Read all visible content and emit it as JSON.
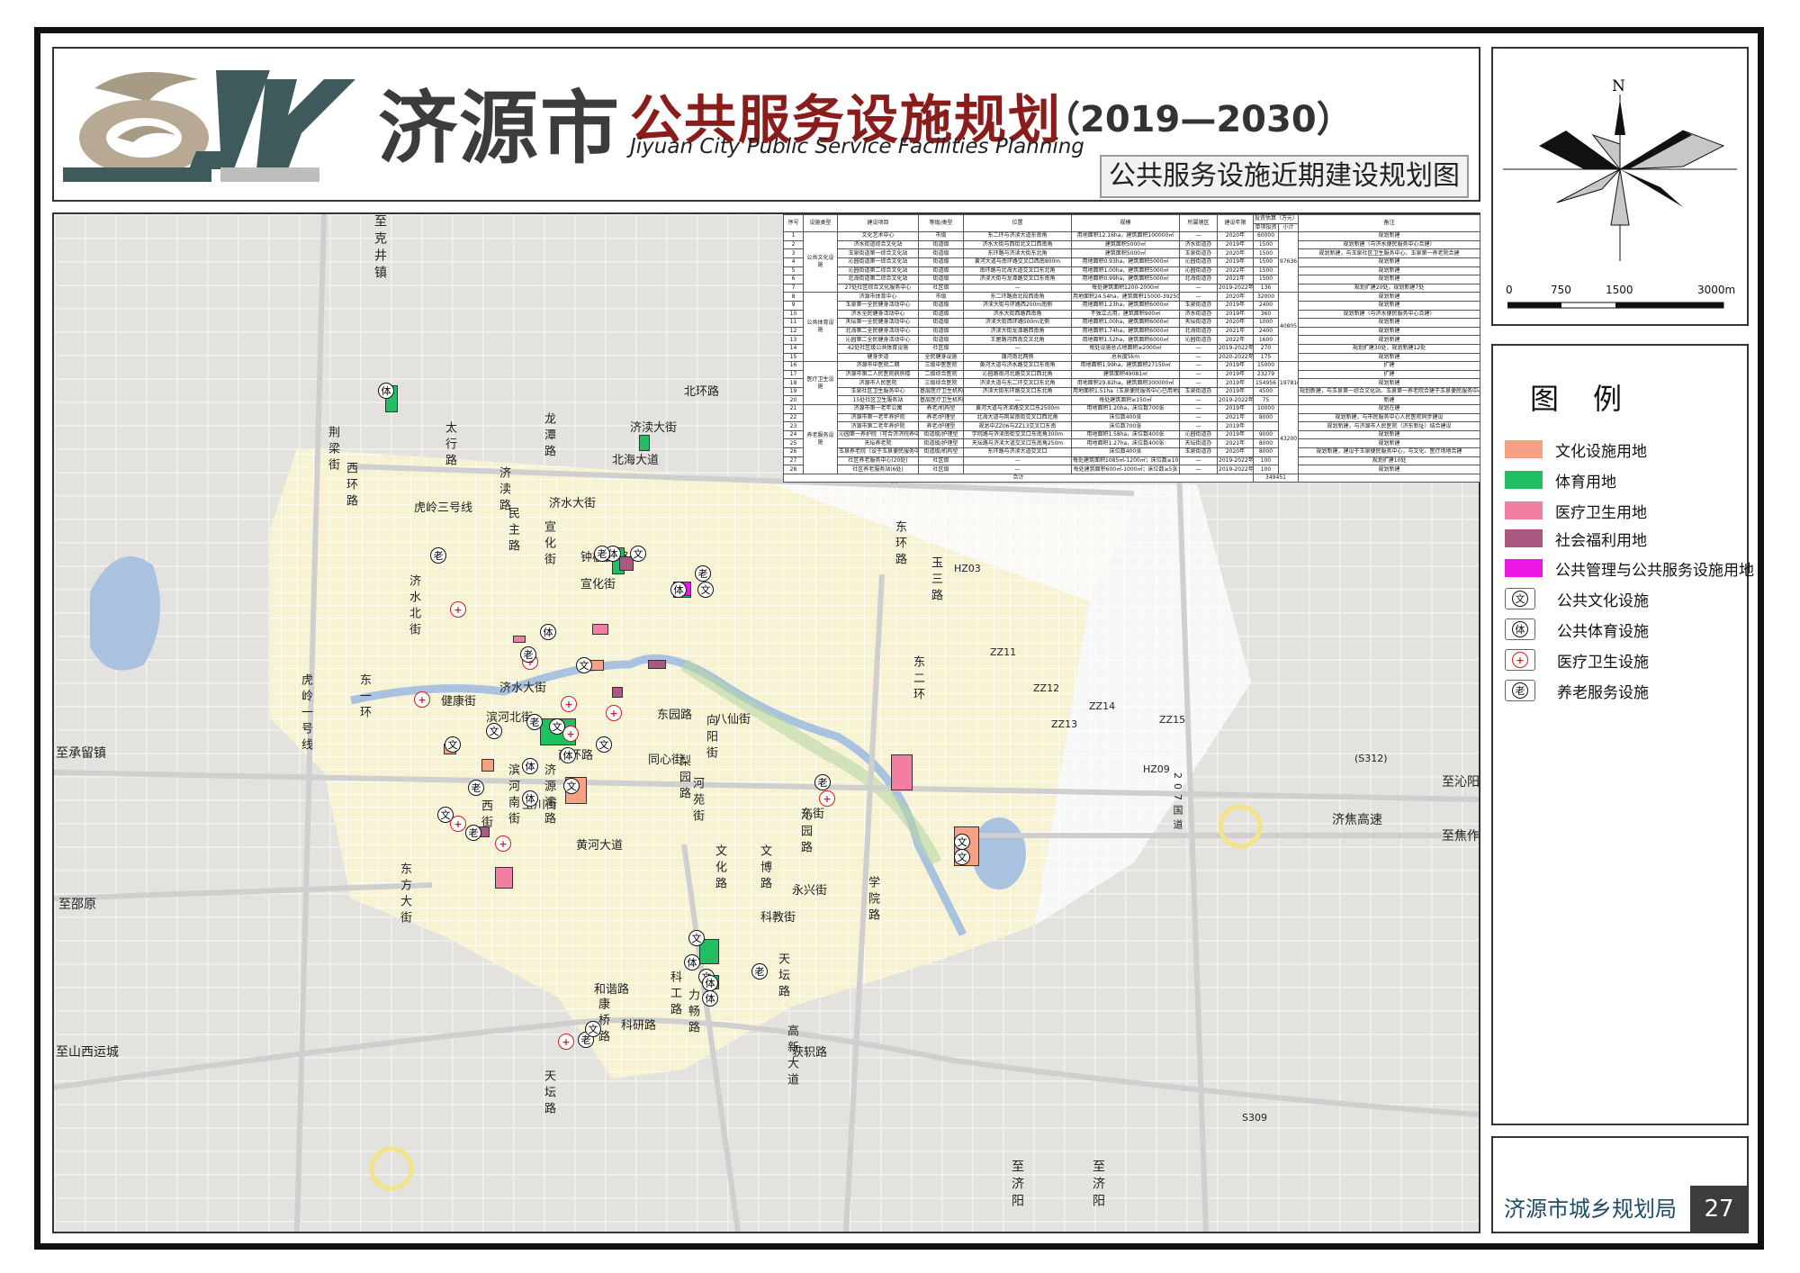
{
  "header": {
    "city": "济源市",
    "plan": "公共服务设施规划",
    "years": "（2019—2030）",
    "english": "Jiyuan City Public Service Facilities Planning",
    "sheet_title": "公共服务设施近期建设规划图",
    "logo_text": "JY"
  },
  "compass": {
    "north": "N"
  },
  "scale": {
    "labels": [
      "0",
      "750",
      "1500",
      "3000m"
    ]
  },
  "legend": {
    "title": "图例",
    "items": [
      {
        "label": "文化设施用地",
        "color": "#f6a183",
        "icon": ""
      },
      {
        "label": "体育用地",
        "color": "#1fbf62",
        "icon": ""
      },
      {
        "label": "医疗卫生用地",
        "color": "#f27fa2",
        "icon": ""
      },
      {
        "label": "社会福利用地",
        "color": "#a9587f",
        "icon": ""
      },
      {
        "label": "公共管理与公共服务设施用地",
        "color": "#ee17e5",
        "icon": ""
      },
      {
        "label": "公共文化设施",
        "color": "",
        "icon": "文"
      },
      {
        "label": "公共体育设施",
        "color": "",
        "icon": "体"
      },
      {
        "label": "医疗卫生设施",
        "color": "",
        "icon": "+"
      },
      {
        "label": "养老服务设施",
        "color": "",
        "icon": "老"
      }
    ]
  },
  "footer": {
    "agency": "济源市城乡规划局",
    "page": "27"
  },
  "table": {
    "headers": [
      "序号",
      "设施类型",
      "建设项目",
      "等级/类型",
      "位置",
      "规模",
      "所属辖区",
      "建设年限",
      "投资估算（万元）",
      "备注"
    ],
    "rows": [
      [
        "1",
        "",
        "文化艺术中心",
        "市级",
        "东二环与济渎大道东南角",
        "用地面积12.16ha，建筑面积100000㎡",
        "—",
        "2020年",
        "60000",
        "规划新建"
      ],
      [
        "2",
        "",
        "济水街道综合文化站",
        "街道级",
        "济水大街与西街北文口西南角",
        "建筑面积5000㎡",
        "济水街道办",
        "2019年",
        "1500",
        "规划新建（与济水便民服务中心合建）"
      ],
      [
        "3",
        "",
        "玉泉街道第一综合文化站",
        "街道级",
        "东环路与济渎大街东北角",
        "建筑面积5000㎡",
        "玉泉街道办",
        "2020年",
        "1500",
        "规划新建，与玉泉社区卫生服务中心、玉泉第一养老院合建"
      ],
      [
        "4",
        "公共文化设施",
        "沁园街道第一综合文化站",
        "街道级",
        "黄河大道与南环路交叉口西南800m",
        "用地面积0.93ha，建筑面积5000㎡",
        "沁园街道办",
        "2019年",
        "1500",
        "规划新建"
      ],
      [
        "5",
        "",
        "沁园街道第二综合文化站",
        "街道级",
        "南环路与北海大道交叉口东北角",
        "用地面积1.00ha，建筑面积5000㎡",
        "沁园街道办",
        "2022年",
        "1500",
        "规划新建"
      ],
      [
        "6",
        "",
        "北海街道第二综合文化站",
        "街道级",
        "济渎大街与龙潭路交叉口东南角",
        "用地面积0.99ha，建筑面积5000㎡",
        "北海街道办",
        "2021年",
        "1500",
        "规划新建"
      ],
      [
        "7",
        "",
        "27处社区综合文化服务中心",
        "社区级",
        "—",
        "每处建筑面积1200-2000㎡",
        "—",
        "2019-2022年",
        "136",
        "规划扩建20处，规划新建7处"
      ],
      [
        "8",
        "",
        "济源市体育中心",
        "市级",
        "东二环路南北段西南角",
        "用地面积24.54ha，建筑面积15000-39250㎡",
        "—",
        "2020年",
        "32000",
        "规划新建"
      ],
      [
        "9",
        "",
        "玉泉第一全民健身活动中心",
        "街道级",
        "济渎大街与环路西200m南侧",
        "用地面积1.23ha，建筑面积6000㎡",
        "玉泉街道办",
        "2019年",
        "2400",
        "规划新建"
      ],
      [
        "10",
        "",
        "济水全民健身活动中心",
        "街道级",
        "济水大街西路西南角",
        "不独立占用，建筑面积900㎡",
        "济水街道办",
        "2019年",
        "360",
        "规划新建（与济水便民服务中心合建）"
      ],
      [
        "11",
        "公共体育设施",
        "天坛第一全民健身活动中心",
        "街道级",
        "济渎大街西环路500m北侧",
        "用地面积1.00ha，建筑面积6000㎡",
        "天坛街道办",
        "2020年",
        "1000",
        "规划新建"
      ],
      [
        "12",
        "",
        "北海第二全民健身活动中心",
        "街道级",
        "济渎大街龙潭路西南角",
        "用地面积1.74ha，建筑面积6000㎡",
        "北海街道办",
        "2021年",
        "2400",
        "规划新建"
      ],
      [
        "13",
        "",
        "沁园第二全民健身活动中心",
        "街道级",
        "王屋路河西南交叉北角",
        "用地面积1.52ha，建筑面积6000㎡",
        "沁园街道办",
        "2022年",
        "1600",
        "规划新建"
      ],
      [
        "14",
        "",
        "42处社区级公共体育设施",
        "社区级",
        "—",
        "每处设施总占地面积≥2000㎡",
        "—",
        "2019-2022年",
        "270",
        "规划扩建30处，规划新建12处"
      ],
      [
        "15",
        "",
        "健身步道",
        "全民健身设施",
        "蒲河南北两侧",
        "总长度5km",
        "—",
        "2020-2022年",
        "175",
        "规划新建"
      ],
      [
        "16",
        "",
        "济源市中医院二期",
        "三级中医医院",
        "黄河大道与济水路交叉口东南角",
        "用地面积1.99ha，建筑面积27150㎡",
        "—",
        "2019年",
        "15000",
        "扩建"
      ],
      [
        "17",
        "",
        "济源市第二人民医院病房楼",
        "二级综合医院",
        "沁园路南河北路交叉口西北角",
        "建筑面积49081㎡",
        "—",
        "2019年",
        "23279",
        "扩建"
      ],
      [
        "18",
        "医疗卫生设施",
        "济源市人民医院",
        "三级综合医院",
        "济渎大道与东二环交叉口东北角",
        "用地面积29.82ha，建筑面积300000㎡",
        "—",
        "2019年",
        "154956",
        "规划新建"
      ],
      [
        "19",
        "",
        "玉泉社区卫生服务中心",
        "基层医疗卫生机构",
        "济渎大街东环路交叉口东北角",
        "用地面积1.51ha（玉泉便民服务中心已用地面积）",
        "玉泉街道办",
        "2019年",
        "4500",
        "规划新建，与玉泉第一综合文化站、玉泉第一养老院合建于玉泉便民服务中心"
      ],
      [
        "20",
        "",
        "15处社区卫生服务站",
        "基层医疗卫生机构",
        "—",
        "每处建筑面积≥150㎡",
        "—",
        "2019-2022年",
        "75",
        "新建"
      ],
      [
        "21",
        "",
        "济源市第一老年公寓",
        "养老/机构型",
        "黄河大道与济渎路交叉口东2500m",
        "用地面积1.20ha，床位数700张",
        "—",
        "2019年",
        "10000",
        "规划在建"
      ],
      [
        "22",
        "",
        "济源市第一老年养护院",
        "养老/护理型",
        "北海大道与荆梁南街交叉口西北角",
        "床位数400张",
        "—",
        "2021年",
        "8000",
        "规划新建，与市民服务中心人民医院同步建设"
      ],
      [
        "23",
        "",
        "济源市第二老年养护院",
        "养老/护理型",
        "规划中ZZ06与ZZ13交叉口东南",
        "床位数700张",
        "—",
        "2019年",
        "",
        "规划新建，与济源市人民医院（济东新址）结合建设"
      ],
      [
        "24",
        "养老服务设施",
        "沁园第一养护院（可合济济院养中心）",
        "街道级/护理型",
        "学院路与济渎南街交叉口东南角300m",
        "用地面积1.58ha，床位数400张",
        "沁园街道办",
        "2019年",
        "9000",
        "规划新建"
      ],
      [
        "25",
        "",
        "天坛养老院",
        "街道级/护理型",
        "天坛路与济渎大道交叉口东南角250m",
        "用地面积1.27ha，床位数400张",
        "天坛街道办",
        "2021年",
        "8000",
        "规划新建"
      ],
      [
        "26",
        "",
        "玉泉养老院（设于玉泉便民服务中心）",
        "街道级/机构型",
        "东环路与济渎大道交叉口",
        "床位数400张",
        "玉泉街道办",
        "2020年",
        "8000",
        "规划新建，建设于玉泉便民服务中心，与文化、医疗场地合建"
      ],
      [
        "27",
        "",
        "社区养老服务中心(20处)",
        "社区级",
        "—",
        "每处建筑面积1085㎡-1200㎡；床位数≥10张",
        "—",
        "2019-2022年",
        "100",
        "规划扩建10处"
      ],
      [
        "28",
        "",
        "社区养老服务站(6处)",
        "社区级",
        "—",
        "每处建筑面积600㎡-1000㎡；床位数≥5张",
        "—",
        "2019-2022年",
        "100",
        "规划新建"
      ],
      [
        "",
        "",
        "",
        "",
        "",
        "",
        "",
        "",
        "349451",
        ""
      ]
    ],
    "sub_headers": [
      "单项投资",
      "小计"
    ],
    "subtotals": [
      "97636",
      "40805",
      "197810",
      "43200"
    ],
    "total_label": "合计"
  },
  "map": {
    "roads": [
      "北环路",
      "济渎大街",
      "北海大道",
      "济水大街",
      "东环路",
      "南环路",
      "黄河大道",
      "获轵路",
      "玉川街",
      "济渎路",
      "文化路",
      "文博路",
      "学院路",
      "科教街",
      "永兴街",
      "同心街",
      "东街",
      "东方大街",
      "济水大街",
      "滨河北街",
      "滨河南街",
      "荆梁街",
      "西环路",
      "太行路",
      "龙潭路",
      "民主路",
      "宣化街",
      "宣化街",
      "钟楼街",
      "桃园路",
      "八仙街",
      "东园路",
      "河苑街",
      "向阳街",
      "沁园路",
      "天坛路",
      "和谐路",
      "科研路",
      "康桥路",
      "科工路",
      "力畅路",
      "高新大道",
      "梨园路",
      "王屋路",
      "玉三路",
      "东二环",
      "东一环",
      "虎岭一号线",
      "虎岭三号线",
      "健康街",
      "济水北街",
      "西街",
      "济源湾路",
      "天坛路",
      "康达路",
      "大街"
    ],
    "road_codes": [
      "HZ03",
      "ZZ11",
      "ZZ12",
      "ZZ13",
      "ZZ14",
      "ZZ15",
      "HZ09",
      "(S312)",
      "S309",
      "207国道"
    ],
    "exits": [
      "至克井镇",
      "至承留镇",
      "至沁阳",
      "至焦作",
      "济焦高速",
      "至邵原",
      "至山西运城",
      "至济阳",
      "至济阳"
    ]
  }
}
